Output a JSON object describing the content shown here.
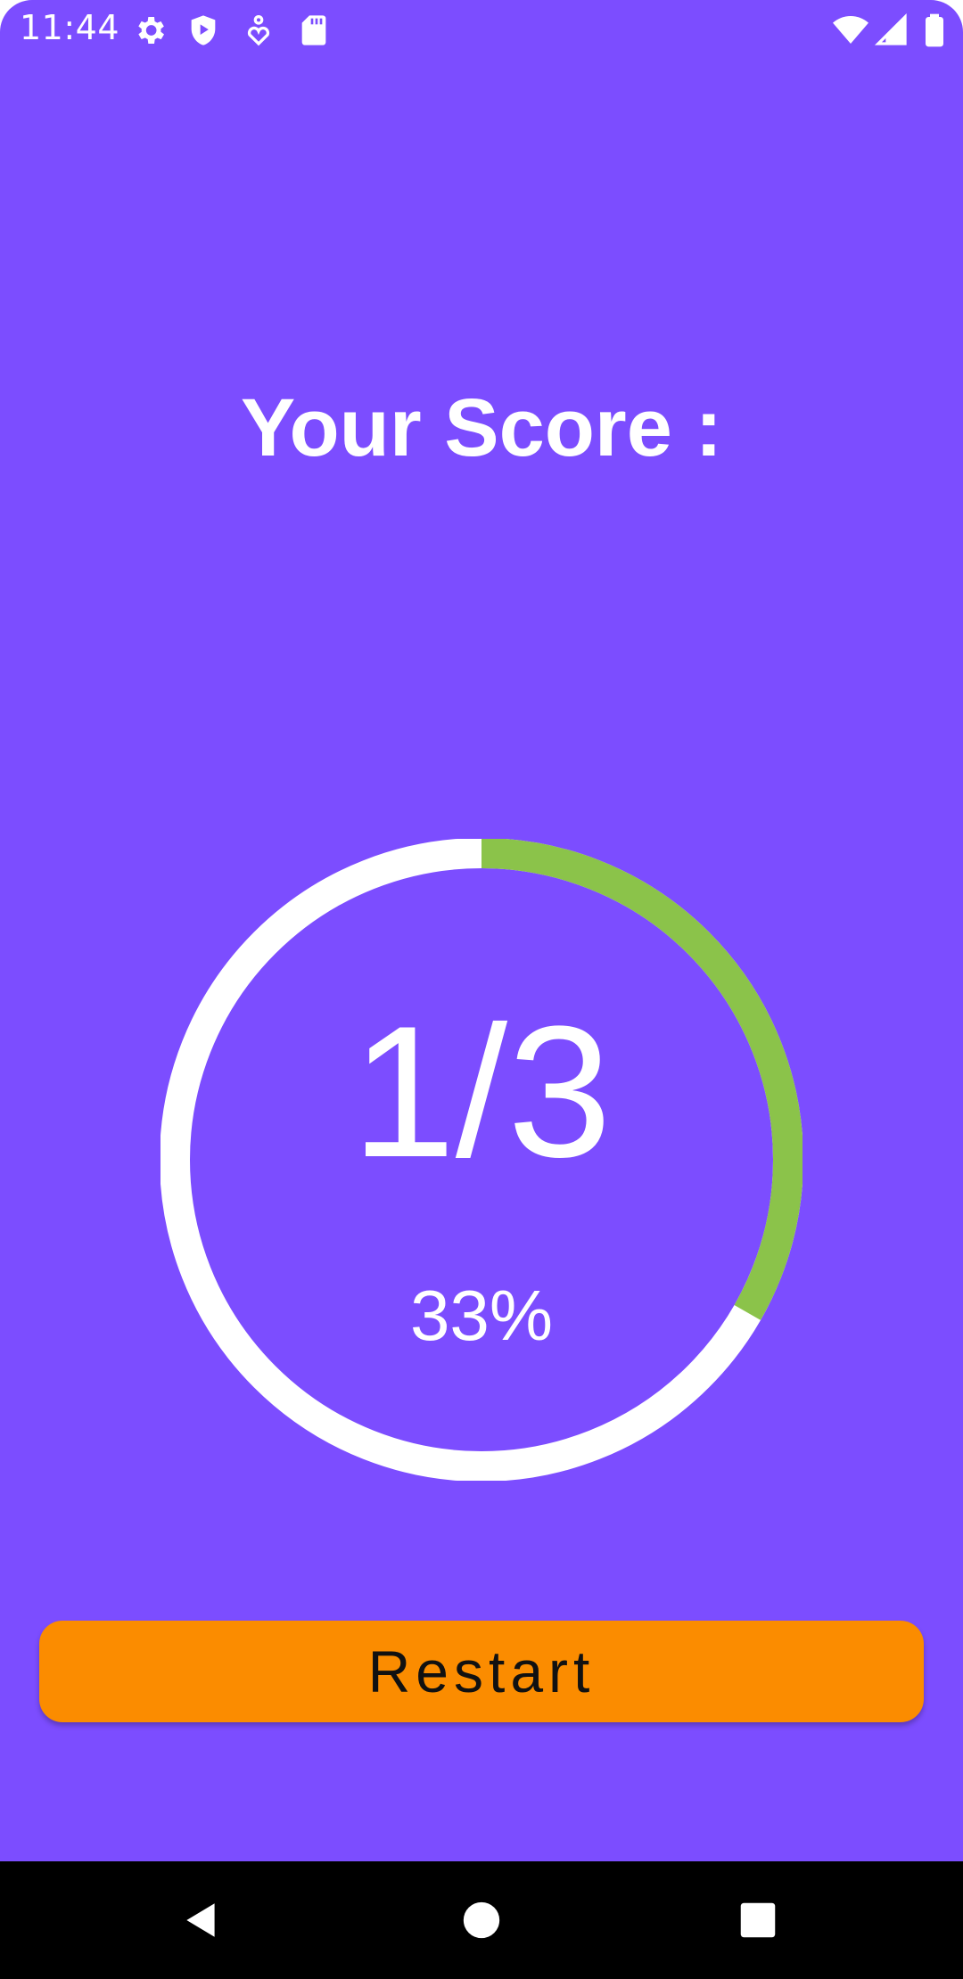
{
  "status_bar": {
    "time": "11:44",
    "left_icons": [
      "gear-icon",
      "shield-play-icon",
      "accessibility-icon",
      "sd-card-icon"
    ],
    "right_icons": [
      "wifi-icon",
      "cellular-signal-icon",
      "battery-icon"
    ]
  },
  "score": {
    "title": "Your Score :",
    "fraction": "1/3",
    "percent_label": "33%",
    "progress": 0.333
  },
  "colors": {
    "background": "#7C4DFF",
    "ring_track": "#FFFFFF",
    "ring_progress": "#8BC34A",
    "button": "#FB8C00"
  },
  "actions": {
    "restart_label": "Restart"
  },
  "nav_bar": {
    "buttons": [
      "back-icon",
      "home-icon",
      "recents-icon"
    ]
  }
}
